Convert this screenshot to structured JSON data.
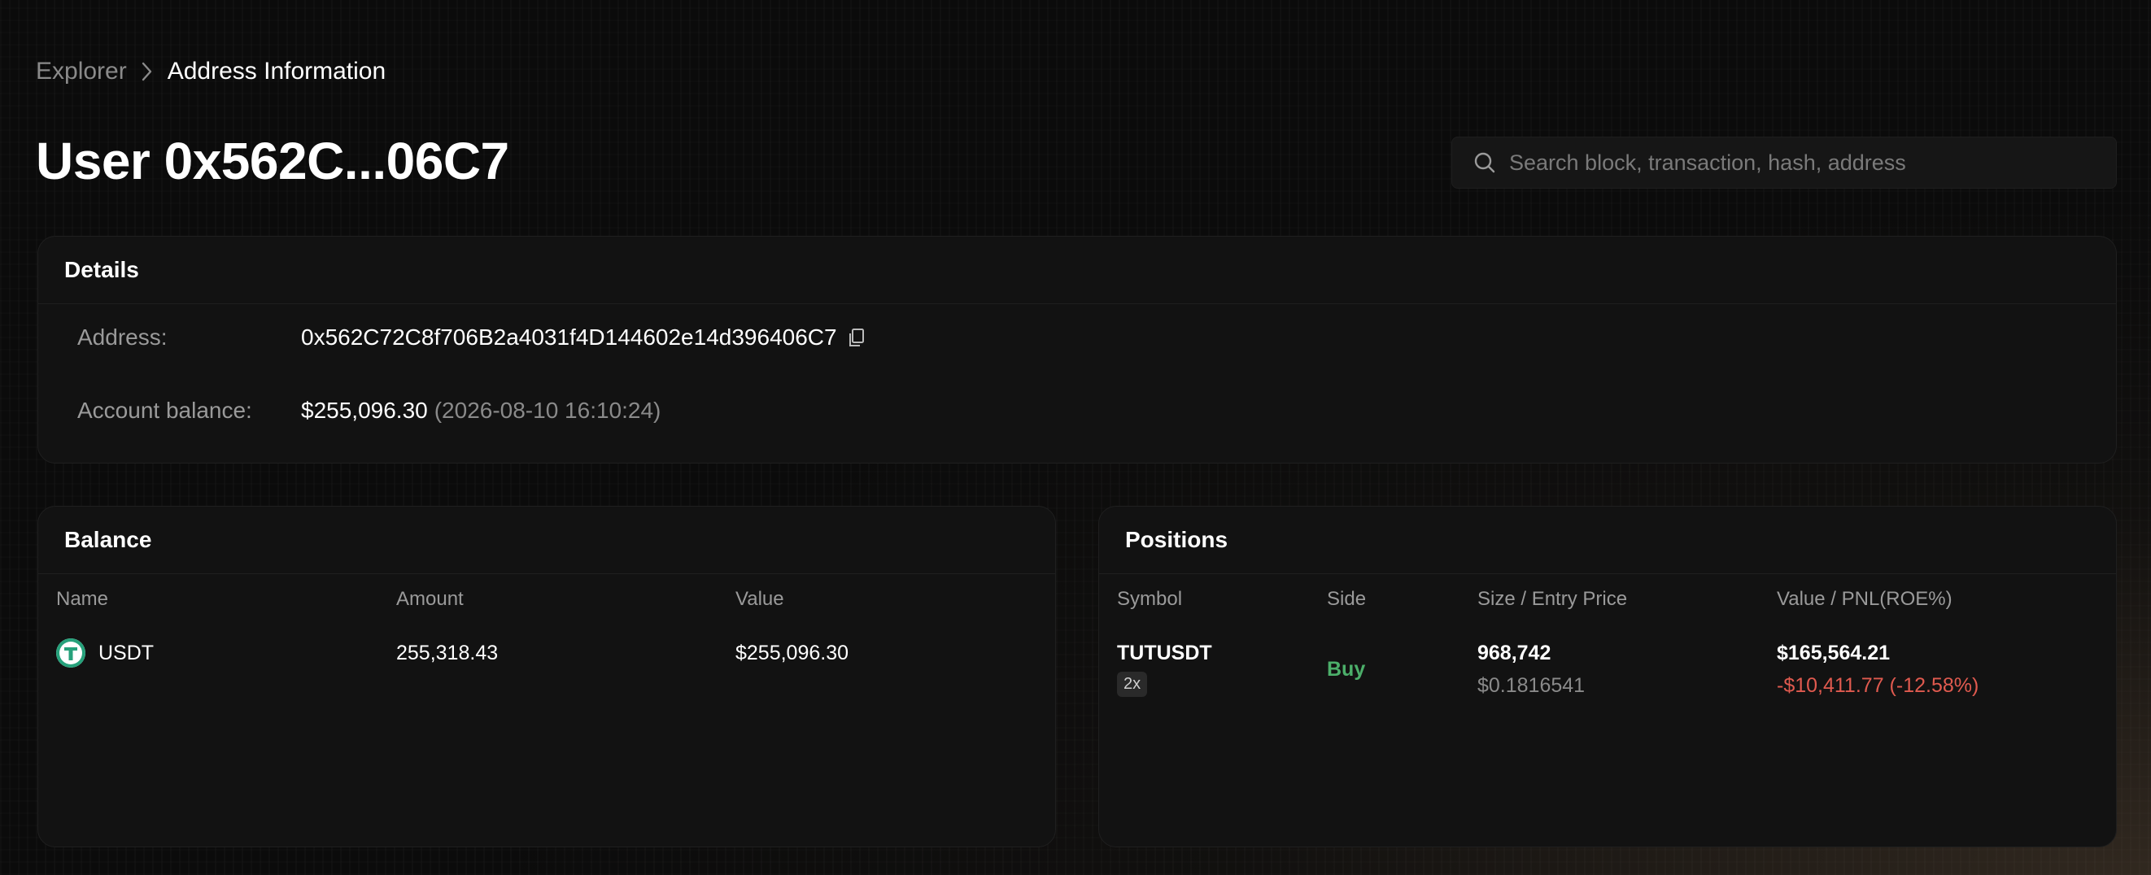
{
  "breadcrumb": {
    "root": "Explorer",
    "current": "Address Information"
  },
  "page_title": "User 0x562C...06C7",
  "search": {
    "placeholder": "Search block, transaction, hash, address",
    "value": ""
  },
  "details": {
    "title": "Details",
    "address_label": "Address:",
    "address_value": "0x562C72C8f706B2a4031f4D144602e14d396406C7",
    "balance_label": "Account balance:",
    "balance_value": "$255,096.30",
    "balance_timestamp": "(2026-08-10 16:10:24)"
  },
  "balance": {
    "title": "Balance",
    "columns": [
      "Name",
      "Amount",
      "Value"
    ],
    "rows": [
      {
        "name": "USDT",
        "icon": "tether-icon",
        "amount": "255,318.43",
        "value": "$255,096.30"
      }
    ]
  },
  "positions": {
    "title": "Positions",
    "columns": [
      "Symbol",
      "Side",
      "Size / Entry Price",
      "Value / PNL(ROE%)"
    ],
    "rows": [
      {
        "symbol": "TUTUSDT",
        "leverage": "2x",
        "side": "Buy",
        "size": "968,742",
        "entry_price": "$0.1816541",
        "value": "$165,564.21",
        "pnl": "-$10,411.77 (-12.58%)"
      }
    ]
  },
  "colors": {
    "background": "#0b0b0b",
    "card": "#121212",
    "buy": "#4caf6a",
    "loss": "#e05a4f",
    "tether": "#26a17b"
  }
}
